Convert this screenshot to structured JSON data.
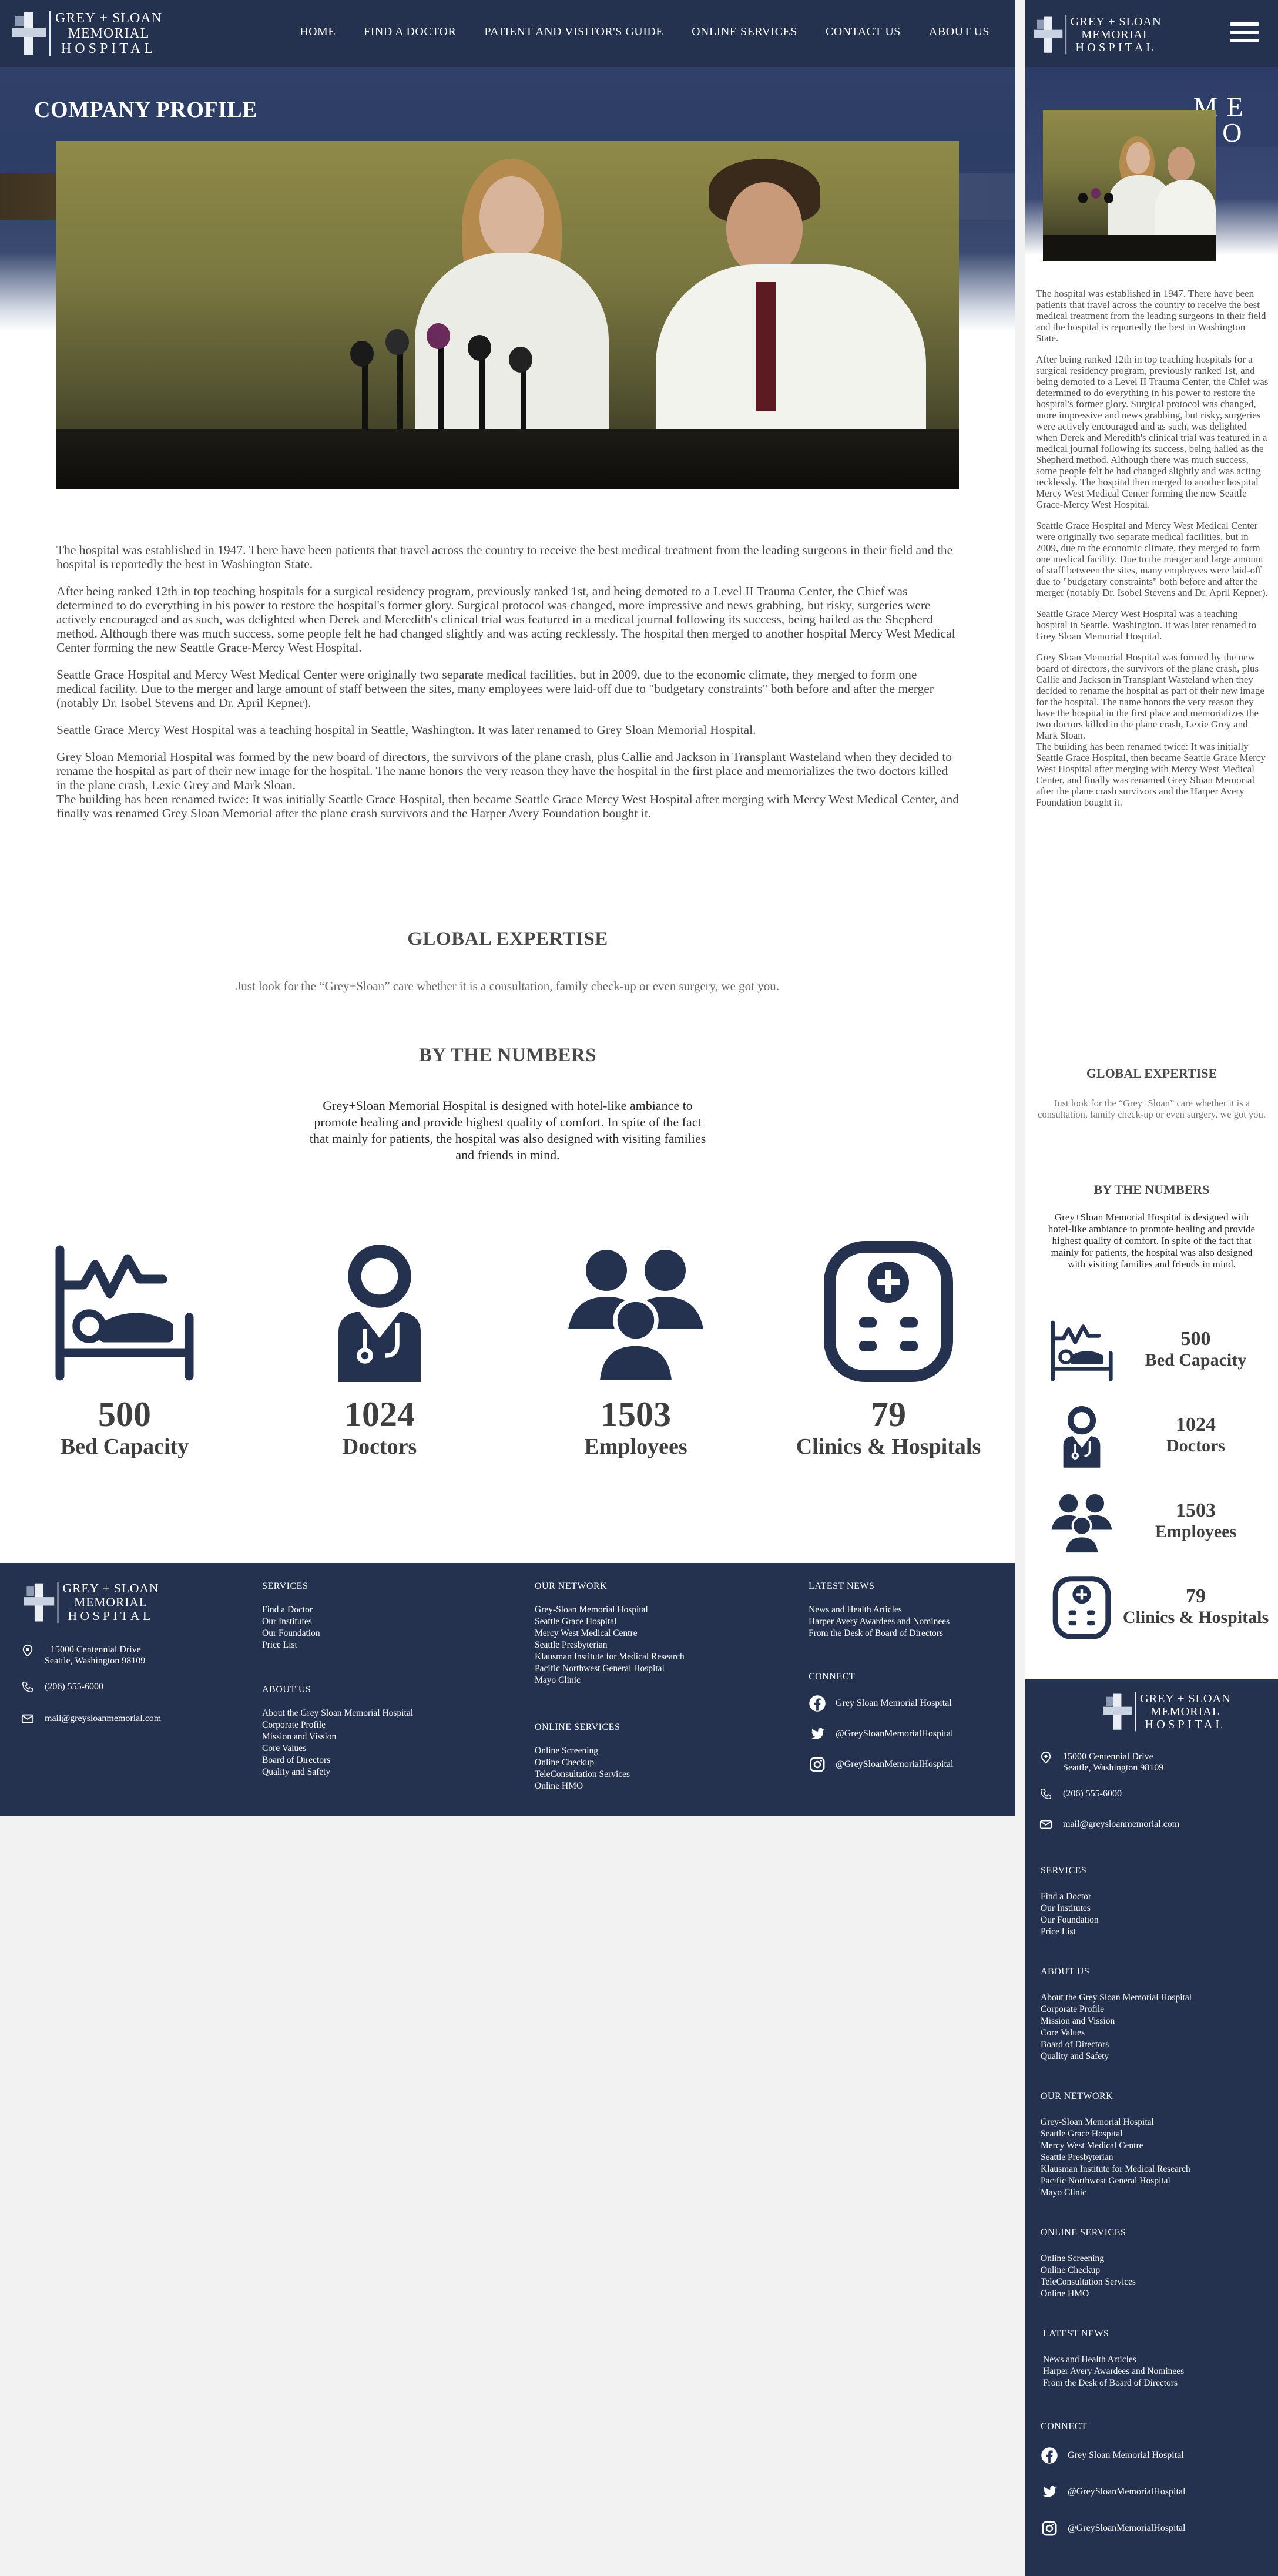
{
  "brand": {
    "line1": "GREY + SLOAN",
    "line2": "MEMORIAL",
    "line3": "HOSPITAL"
  },
  "nav": [
    {
      "label": "HOME"
    },
    {
      "label": "FIND A DOCTOR"
    },
    {
      "label": "PATIENT AND VISITOR'S GUIDE"
    },
    {
      "label": "ONLINE SERVICES"
    },
    {
      "label": "CONTACT US"
    },
    {
      "label": "ABOUT US"
    }
  ],
  "hero": {
    "title": "COMPANY PROFILE",
    "mobile_ribbon": "ME HO"
  },
  "about": {
    "p1": "The hospital was established in 1947. There have been patients that travel across the country to receive the best medical treatment from the leading surgeons in their field and the hospital is reportedly the best in Washington State.",
    "p2": "After being ranked 12th in top teaching hospitals for a surgical residency program, previously ranked 1st, and being demoted to a Level II Trauma Center, the Chief was determined to do everything in his power to restore the hospital's former glory. Surgical protocol was changed, more impressive and news grabbing, but risky, surgeries were actively encouraged and as such, was delighted when Derek and Meredith's clinical trial was featured in a medical journal following its success, being hailed as the Shepherd method. Although there was much success, some people felt he had changed slightly and was acting recklessly. The hospital then merged to another hospital Mercy West Medical Center forming the new Seattle Grace-Mercy West Hospital.",
    "p3": "Seattle Grace Hospital and Mercy West Medical Center were originally two separate medical facilities, but in 2009, due to the economic climate, they merged to form one medical facility. Due to the merger and large amount of staff between the sites, many employees were laid-off due to \"budgetary constraints\" both before and after the merger (notably Dr. Isobel Stevens and Dr. April Kepner).",
    "p4": "Seattle Grace Mercy West Hospital was a teaching hospital in Seattle, Washington. It was later renamed to Grey Sloan Memorial Hospital.",
    "p5": "Grey Sloan Memorial Hospital was formed by the new board of directors, the survivors of the plane crash, plus Callie and Jackson in Transplant Wasteland when they decided to rename the hospital as part of their new image for the hospital. The name honors the very reason they have the hospital in the first place and memorializes the two doctors killed in the plane crash, Lexie Grey and Mark Sloan.",
    "p6": "The building has been renamed twice: It was initially Seattle Grace Hospital, then became Seattle Grace Mercy West Hospital after merging with Mercy West Medical Center, and finally was renamed Grey Sloan Memorial after the plane crash survivors and the Harper Avery Foundation bought it."
  },
  "expertise": {
    "title": "GLOBAL EXPERTISE",
    "text": "Just look for the “Grey+Sloan” care whether it is a consultation, family check-up or even surgery, we got you."
  },
  "numbers": {
    "title": "BY THE NUMBERS",
    "text": "Grey+Sloan Memorial Hospital is designed with hotel-like ambiance to promote healing and provide highest quality of comfort. In spite of the fact that mainly for patients, the hospital was also designed with visiting families and friends in mind.",
    "stats": [
      {
        "value": "500",
        "label": "Bed Capacity",
        "icon": "bed-icon"
      },
      {
        "value": "1024",
        "label": "Doctors",
        "icon": "doctor-icon"
      },
      {
        "value": "1503",
        "label": "Employees",
        "icon": "employees-icon"
      },
      {
        "value": "79",
        "label": "Clinics & Hospitals",
        "icon": "clinic-icon"
      }
    ]
  },
  "footer": {
    "address_line1": "15000 Centennial Drive",
    "address_line2": "Seattle, Washington 98109",
    "phone": "(206) 555-6000",
    "email": "mail@greysloanmemorial.com",
    "services": {
      "head": "SERVICES",
      "items": [
        "Find a Doctor",
        "Our Institutes",
        "Our Foundation",
        "Price List"
      ]
    },
    "about": {
      "head": "ABOUT US",
      "items": [
        "About the Grey Sloan Memorial Hospital",
        "Corporate Profile",
        "Mission and Vission",
        "Core Values",
        "Board of Directors",
        "Quality and Safety"
      ]
    },
    "network": {
      "head": "OUR NETWORK",
      "items": [
        "Grey-Sloan Memorial Hospital",
        "Seattle Grace Hospital",
        "Mercy West Medical Centre",
        "Seattle Presbyterian",
        "Klausman Institute for Medical Research",
        "Pacific Northwest General Hospital",
        "Mayo Clinic"
      ]
    },
    "online": {
      "head": "ONLINE SERVICES",
      "items": [
        "Online Screening",
        "Online Checkup",
        "TeleConsultation Services",
        "Online HMO"
      ]
    },
    "news": {
      "head": "LATEST NEWS",
      "items": [
        "News and Health Articles",
        "Harper Avery Awardees and Nominees",
        "From the Desk of Board of Directors"
      ]
    },
    "connect": {
      "head": "CONNECT",
      "facebook": "Grey Sloan Memorial Hospital",
      "twitter": "@GreySloanMemorialHospital",
      "instagram": "@GreySloanMemorialHospital"
    }
  },
  "colors": {
    "navy": "#25324f",
    "white": "#ffffff",
    "text": "#4a4a4a"
  }
}
